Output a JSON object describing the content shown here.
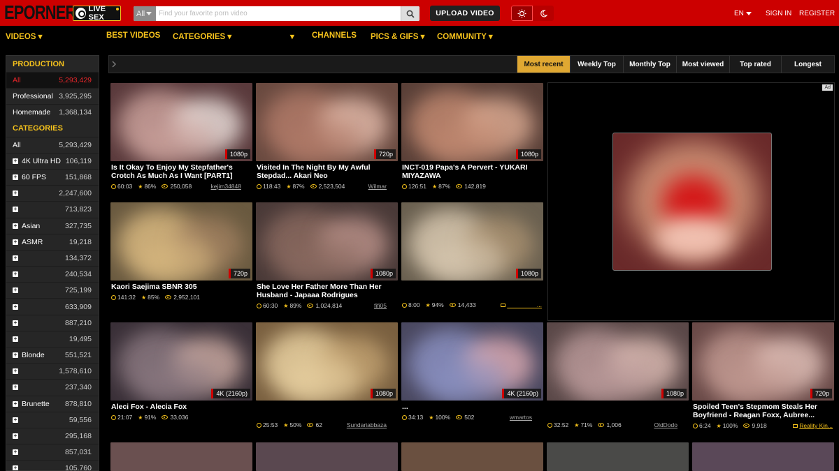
{
  "header": {
    "logo": "EPORNER",
    "livesex_label": "LIVE SEX",
    "search_category": "All",
    "search_placeholder": "Find your favorite porn video",
    "upload_label": "UPLOAD VIDEO",
    "language": "EN",
    "signin": "SIGN IN",
    "register": "REGISTER"
  },
  "nav": {
    "videos": "VIDEOS ▾",
    "best": "BEST VIDEOS",
    "categories": "CATEGORIES ▾",
    "more": "▾",
    "channels": "CHANNELS",
    "pics": "PICS & GIFS ▾",
    "community": "COMMUNITY ▾"
  },
  "sidebar": {
    "production_heading": "PRODUCTION",
    "production": [
      {
        "name": "All",
        "count": "5,293,429"
      },
      {
        "name": "Professional",
        "count": "3,925,295"
      },
      {
        "name": "Homemade",
        "count": "1,368,134"
      }
    ],
    "categories_heading": "CATEGORIES",
    "categories": [
      {
        "name": "All",
        "count": "5,293,429"
      },
      {
        "name": "4K Ultra HD",
        "count": "106,119"
      },
      {
        "name": "60 FPS",
        "count": "151,868"
      },
      {
        "name": "",
        "count": "2,247,600"
      },
      {
        "name": "",
        "count": "713,823"
      },
      {
        "name": "Asian",
        "count": "327,735"
      },
      {
        "name": "ASMR",
        "count": "19,218"
      },
      {
        "name": "",
        "count": "134,372"
      },
      {
        "name": "",
        "count": "240,534"
      },
      {
        "name": "",
        "count": "725,199"
      },
      {
        "name": "",
        "count": "633,909"
      },
      {
        "name": "",
        "count": "887,210"
      },
      {
        "name": "",
        "count": "19,495"
      },
      {
        "name": "Blonde",
        "count": "551,521"
      },
      {
        "name": "",
        "count": "1,578,610"
      },
      {
        "name": "",
        "count": "237,340"
      },
      {
        "name": "Brunette",
        "count": "878,810"
      },
      {
        "name": "",
        "count": "59,556"
      },
      {
        "name": "",
        "count": "295,168"
      },
      {
        "name": "",
        "count": "857,031"
      },
      {
        "name": "",
        "count": "105,760"
      }
    ]
  },
  "sort_tabs": [
    "Most recent",
    "Weekly Top",
    "Monthly Top",
    "Most viewed",
    "Top rated",
    "Longest"
  ],
  "ad_label": "Ad",
  "videos": [
    {
      "title": "Is It Okay To Enjoy My Stepfather's Crotch As Much As I Want [PART1]",
      "quality": "1080p",
      "duration": "60:03",
      "rating": "86%",
      "views": "250,058",
      "uploader": "kejim34848"
    },
    {
      "title": "Visited In The Night By My Awful Stepdad... Akari Neo",
      "quality": "720p",
      "duration": "118:43",
      "rating": "87%",
      "views": "2,523,504",
      "uploader": "Wilmar"
    },
    {
      "title": "INCT-019 Papa's A Pervert - YUKARI MIYAZAWA",
      "quality": "1080p",
      "duration": "126:51",
      "rating": "87%",
      "views": "142,819",
      "uploader": ""
    },
    {
      "title": "Kaori Saejima SBNR 305",
      "quality": "720p",
      "duration": "141:32",
      "rating": "85%",
      "views": "2,952,101",
      "uploader": ""
    },
    {
      "title": "She Love Her Father More Than Her Husband - Japaaa Rodrigues",
      "quality": "1080p",
      "duration": "60:30",
      "rating": "89%",
      "views": "1,024,814",
      "uploader": "fifi05"
    },
    {
      "title": "",
      "quality": "1080p",
      "duration": "8:00",
      "rating": "94%",
      "views": "14,433",
      "uploader": "_________..."
    },
    {
      "title": "Aleci Fox - Alecia Fox",
      "quality": "4K (2160p)",
      "duration": "21:07",
      "rating": "91%",
      "views": "33,036",
      "uploader": ""
    },
    {
      "title": "",
      "quality": "1080p",
      "duration": "25:53",
      "rating": "50%",
      "views": "62",
      "uploader": "Sundariabbaza"
    },
    {
      "title": "...",
      "quality": "4K (2160p)",
      "duration": "34:13",
      "rating": "100%",
      "views": "502",
      "uploader": "wmartos"
    },
    {
      "title": "",
      "quality": "1080p",
      "duration": "32:52",
      "rating": "71%",
      "views": "1,006",
      "uploader": "OldDodo"
    },
    {
      "title": "Spoiled Teen's Stepmom Steals Her Boyfriend - Reagan Foxx, Aubree...",
      "quality": "720p",
      "duration": "6:24",
      "rating": "100%",
      "views": "9,918",
      "uploader": "Reality Kin..."
    }
  ],
  "colors": {
    "header_red": "#cc0000",
    "accent_gold": "#f5c21c",
    "active_tab": "#e0a832",
    "active_red": "#e8262a"
  }
}
